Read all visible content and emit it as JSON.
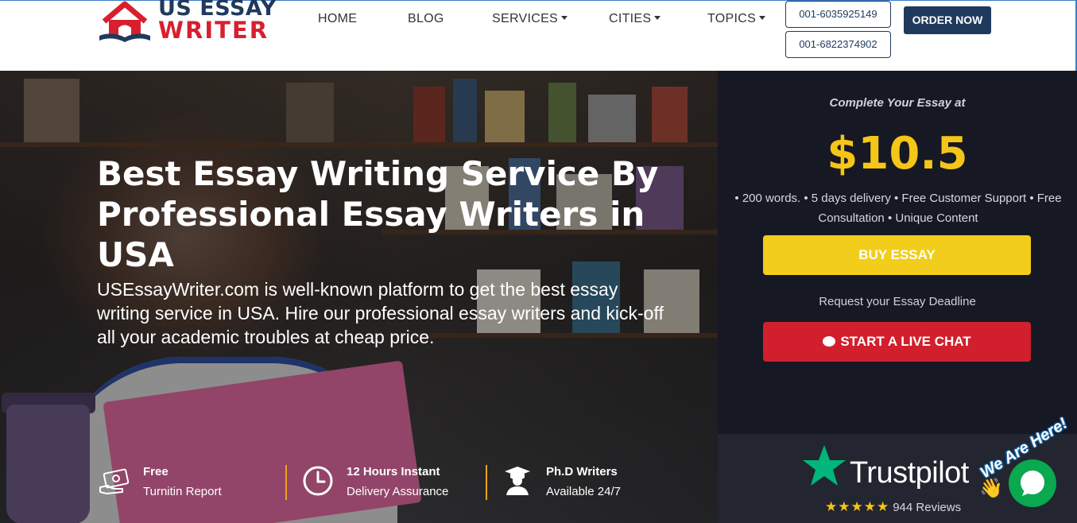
{
  "header": {
    "logo": {
      "line1": "US ESSAY",
      "line2": "WRITER"
    },
    "nav": [
      {
        "label": "HOME",
        "dropdown": false
      },
      {
        "label": "BLOG",
        "dropdown": false
      },
      {
        "label": "SERVICES",
        "dropdown": true
      },
      {
        "label": "CITIES",
        "dropdown": true
      },
      {
        "label": "TOPICS",
        "dropdown": true
      }
    ],
    "phones": [
      "001-6035925149",
      "001-6822374902"
    ],
    "order_label": "ORDER NOW"
  },
  "hero": {
    "title": "Best Essay Writing Service By Professional Essay Writers in USA",
    "description": "USEssayWriter.com is well-known platform to get the best essay writing service in USA. Hire our professional essay writers and kick-off all your academic troubles at cheap price.",
    "features": [
      {
        "icon": "money-icon",
        "line1": "Free",
        "line2": "Turnitin Report"
      },
      {
        "icon": "clock-icon",
        "line1": "12 Hours Instant",
        "line2": "Delivery Assurance"
      },
      {
        "icon": "graduate-icon",
        "line1": "Ph.D Writers",
        "line2": "Available 24/7"
      }
    ]
  },
  "panel": {
    "subtitle": "Complete Your Essay at",
    "price": "$10.5",
    "features": "• 200 words. • 5 days delivery • Free Customer Support • Free Consultation • Unique Content",
    "buy_label": "BUY ESSAY",
    "deadline_text": "Request your Essay Deadline",
    "chat_label": "START A LIVE CHAT"
  },
  "trustpilot": {
    "brand": "Trustpilot",
    "stars": "★★★★★",
    "reviews": "944 Reviews"
  },
  "chat_widget": {
    "tagline": "We Are Here!"
  },
  "colors": {
    "brand_navy": "#1f3a5c",
    "brand_red": "#d81f2e",
    "price_yellow": "#f5c518",
    "buy_yellow": "#f2cd1b",
    "chat_red": "#d11f2d",
    "panel_bg": "#161823",
    "trustpilot_green": "#00b67a",
    "divider_orange": "#f2a21a"
  }
}
